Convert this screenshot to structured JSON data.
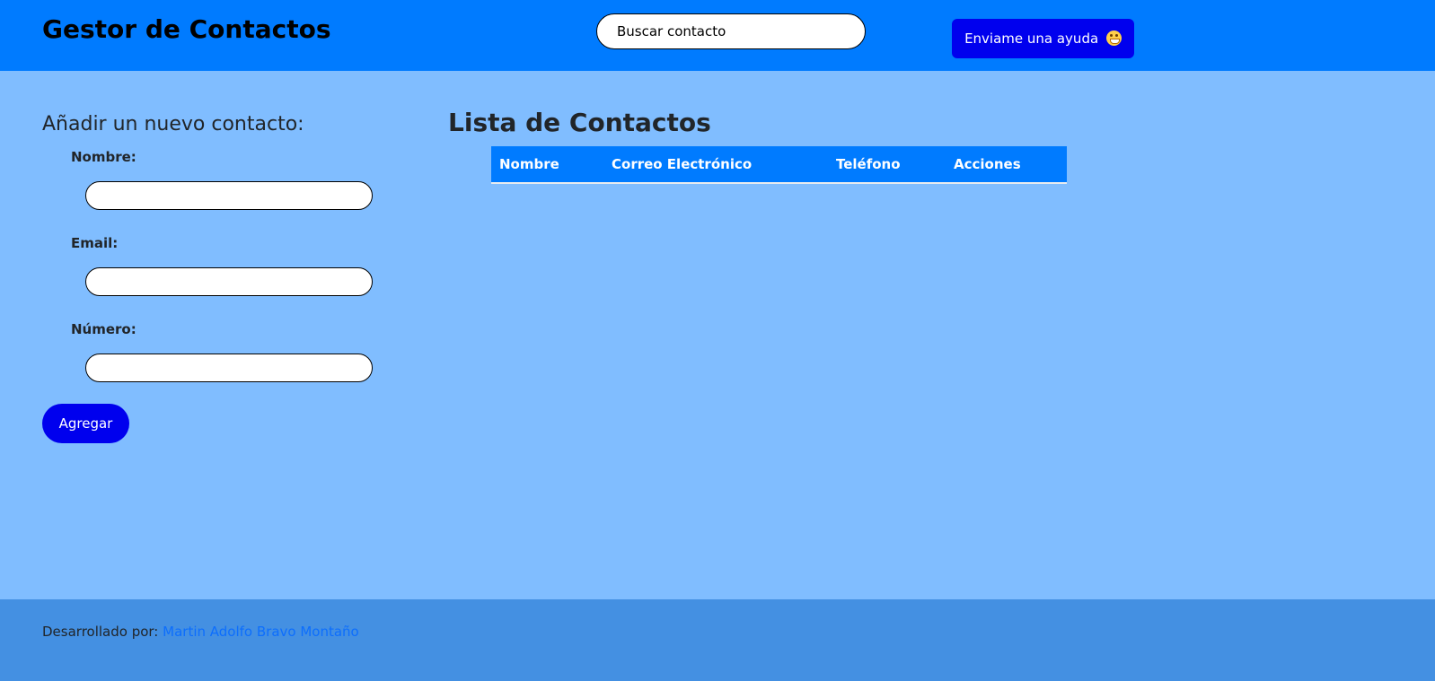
{
  "header": {
    "title": "Gestor de Contactos",
    "search_placeholder": "Buscar contacto",
    "help_button_label": "Enviame una ayuda",
    "help_button_icon": "grinning-face-emoji-icon"
  },
  "add_form": {
    "title": "Añadir un nuevo contacto:",
    "fields": [
      {
        "label": "Nombre:",
        "value": ""
      },
      {
        "label": "Email:",
        "value": ""
      },
      {
        "label": "Número:",
        "value": ""
      }
    ],
    "submit_label": "Agregar"
  },
  "contact_list": {
    "title": "Lista de Contactos",
    "columns": [
      "Nombre",
      "Correo Electrónico",
      "Teléfono",
      "Acciones"
    ],
    "rows": []
  },
  "footer": {
    "prefix": "Desarrollado por:",
    "author_link": "Martin Adolfo Bravo Montaño"
  },
  "colors": {
    "header_bg": "#007bff",
    "page_bg": "#80bdff",
    "footer_bg": "#4490e2",
    "button_bg": "#0000ee",
    "link": "#0d6efd"
  }
}
